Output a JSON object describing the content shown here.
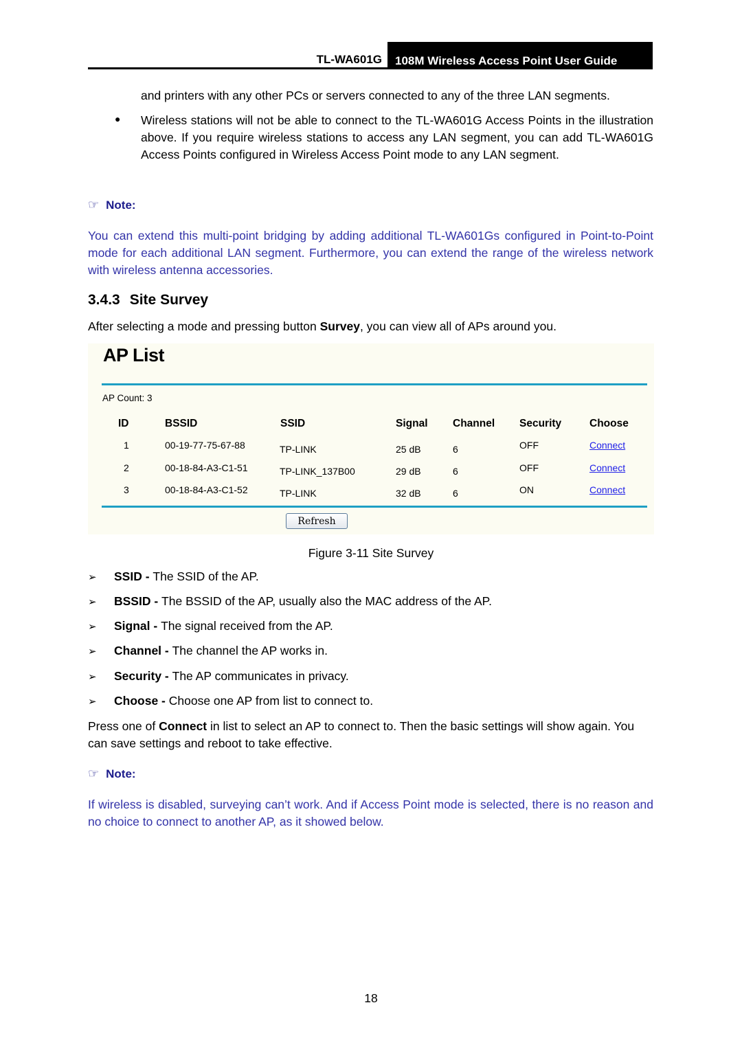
{
  "header": {
    "model": "TL-WA601G",
    "guide_title": "108M Wireless Access Point User Guide"
  },
  "intro": {
    "continuation": "and printers with any other PCs or servers connected to any of the three LAN segments.",
    "bullet": "Wireless stations will not be able to connect to the TL-WA601G Access Points in the illustration above. If you require wireless stations to access any LAN segment, you can add TL-WA601G Access Points configured in Wireless Access Point mode to any LAN segment."
  },
  "note1": {
    "icon": "pointing-hand-icon",
    "title": "Note:",
    "text": "You can extend this multi-point bridging by adding additional TL-WA601Gs configured in Point-to-Point mode for each additional LAN segment. Furthermore, you can extend the range of the wireless network with wireless antenna accessories."
  },
  "section": {
    "number": "3.4.3",
    "title": "Site Survey",
    "intro_prefix": "After selecting a mode and pressing button ",
    "intro_bold": "Survey",
    "intro_suffix": ", you can view all of APs around you."
  },
  "ap_list": {
    "title": "AP List",
    "count_label": "AP Count: 3",
    "columns": [
      "ID",
      "BSSID",
      "SSID",
      "Signal",
      "Channel",
      "Security",
      "Choose"
    ],
    "rows": [
      {
        "id": "1",
        "bssid": "00-19-77-75-67-88",
        "ssid": "TP-LINK",
        "signal": "25 dB",
        "channel": "6",
        "security": "OFF",
        "choose": "Connect"
      },
      {
        "id": "2",
        "bssid": "00-18-84-A3-C1-51",
        "ssid": "TP-LINK_137B00",
        "signal": "29 dB",
        "channel": "6",
        "security": "OFF",
        "choose": "Connect"
      },
      {
        "id": "3",
        "bssid": "00-18-84-A3-C1-52",
        "ssid": "TP-LINK",
        "signal": "32 dB",
        "channel": "6",
        "security": "ON",
        "choose": "Connect"
      }
    ],
    "refresh_label": "Refresh",
    "colors": {
      "rule": "#1e9fc4",
      "background": "#fcfcf2",
      "link": "#2020e8"
    }
  },
  "figure_caption": "Figure 3-11 Site Survey",
  "definitions": [
    {
      "term": "SSID - ",
      "desc": "The SSID of the AP."
    },
    {
      "term": "BSSID - ",
      "desc": "The BSSID of the AP, usually also the MAC address of the AP."
    },
    {
      "term": "Signal - ",
      "desc": "The signal received from the AP."
    },
    {
      "term": "Channel - ",
      "desc": "The channel the AP works in."
    },
    {
      "term": "Security - ",
      "desc": "The AP communicates in privacy."
    },
    {
      "term": "Choose - ",
      "desc": "Choose one AP from list to connect to."
    }
  ],
  "connect_paragraph": {
    "prefix": "Press one of ",
    "bold": "Connect",
    "suffix": " in list to select an AP to connect to. Then the basic settings will show again. You can save settings and reboot to take effective."
  },
  "note2": {
    "icon": "pointing-hand-icon",
    "title": "Note:",
    "text": "If wireless is disabled, surveying can’t work. And if Access Point mode is selected, there is no reason and no choice to connect to another AP, as it showed below."
  },
  "page_number": "18",
  "colors": {
    "note_text": "#3333a8",
    "note_title": "#1c1c8c"
  }
}
